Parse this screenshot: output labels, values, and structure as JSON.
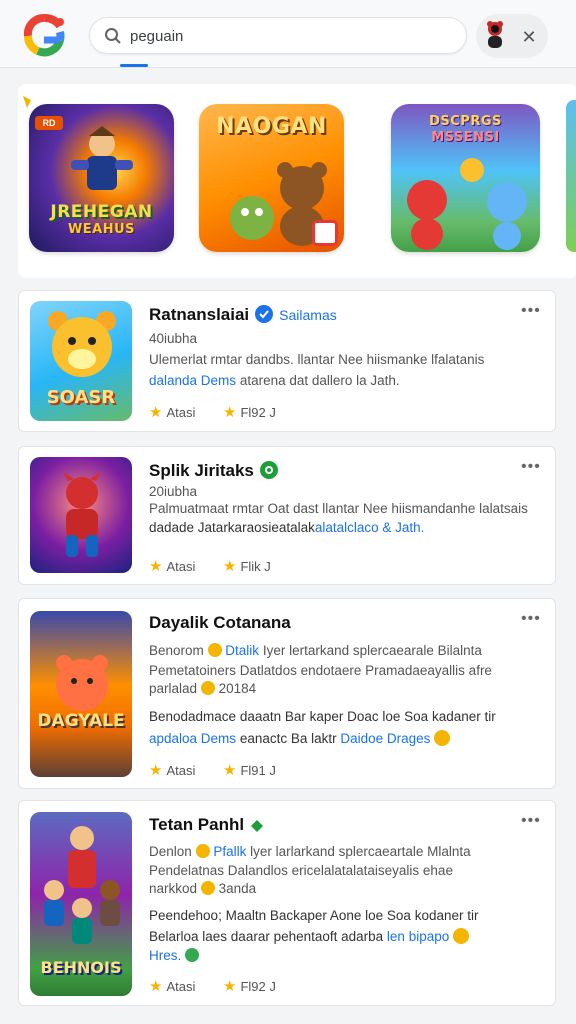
{
  "search": {
    "value": "peguain"
  },
  "featured": [
    {
      "label": "JREHEGAN\nWEAHUS",
      "badge": "RD"
    },
    {
      "label": "NAOGAN"
    },
    {
      "label": "DSCPRGS\nMSSENSI"
    }
  ],
  "results": [
    {
      "title": "Ratnanslaiai",
      "tag": "Sailamas",
      "meta": "40iubha",
      "desc1": "Ulemerlat rmtar dandbs. llantar Nee hiismanke lfalatanis",
      "desc2_link": "dalanda Dems",
      "desc2_rest": " atarena dat dallero la Jath.",
      "rating_a": "Atasi",
      "rating_b": "Fl92 J",
      "thumb_label": "SOASR"
    },
    {
      "title": "Splik Jiritaks",
      "meta": "20iubha",
      "desc1": "Palmuatmaat rmtar Oat dast llantar Nee hiismandanhe lalatsais",
      "desc2_prefix": "dadade Jatarkaraosieatalak",
      "desc2_link": "alatalclaco & Jath.",
      "rating_a": "Atasi",
      "rating_b": "Flik J",
      "thumb_label": ""
    },
    {
      "title": "Dayalik Cotanana",
      "desc1_prefix": "Benorom ",
      "desc1_link": "Dtalik",
      "desc1_rest": " Iyer lertarkand splercaearale Bilalnta",
      "desc2": "Pemetatoiners Datlatdos endotaere Pramadaeayallis afre",
      "desc3": "parlalad",
      "desc3_num": "20184",
      "desc4": "Benodadmace daaatn Bar kaper Doac loe Soa kadaner tir",
      "desc5_link": "apdaloa Dems",
      "desc5_mid": " eanactc Ba laktr ",
      "desc5_link2": "Daidoe Drages",
      "rating_a": "Atasi",
      "rating_b": "Fl91 J",
      "thumb_label": "DAGYALE"
    },
    {
      "title": "Tetan Panhl",
      "desc1_prefix": "Denlon ",
      "desc1_link": "Pfallk",
      "desc1_rest": " lyer larlarkand splercaeartale Mlalnta",
      "desc2": "Pendelatnas Dalandlos ericelalatalataiseyalis ehae",
      "desc3": "narkkod",
      "desc3_num": "3anda",
      "desc4": "Peendehoo; Maaltn Backaper Aone loe Soa kodaner tir",
      "desc5": "Belarloa laes daarar pehentaoft adarba ",
      "desc5_link": "len bipapo",
      "desc6_link": "Hres.",
      "rating_a": "Atasi",
      "rating_b": "Fl92 J",
      "thumb_label": "BEHNOIS"
    }
  ],
  "colors": {
    "accent": "#1a73e8",
    "star": "#f4b400",
    "verified_blue": "#1a73e8",
    "verified_green": "#1e9e3a"
  }
}
